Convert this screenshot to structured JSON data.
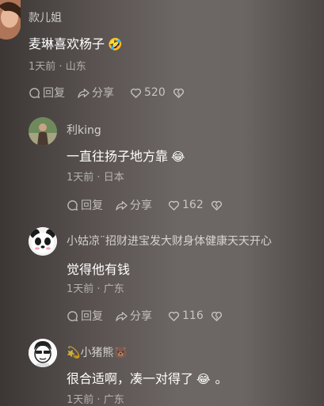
{
  "comments": [
    {
      "username": "款儿姐",
      "text": "麦琳喜欢杨子",
      "emoji": "🤣",
      "time": "1天前",
      "location": "山东",
      "reply_label": "回复",
      "share_label": "分享",
      "likes": "520"
    },
    {
      "username": "利king",
      "text": "一直往扬子地方靠",
      "emoji": "😂",
      "time": "1天前",
      "location": "日本",
      "reply_label": "回复",
      "share_label": "分享",
      "likes": "162"
    },
    {
      "username": "小姑凉¨招财进宝发大财身体健康天天开心",
      "text": "觉得他有钱",
      "time": "1天前",
      "location": "广东",
      "reply_label": "回复",
      "share_label": "分享",
      "likes": "116"
    },
    {
      "username_prefix_emoji": "💫",
      "username": "小猪熊",
      "username_suffix_emoji": "🐻",
      "text": "很合适啊，凑一对得了",
      "emoji": "😂",
      "text_suffix": "。",
      "time": "1天前",
      "location": "广东"
    }
  ],
  "separator": " · "
}
